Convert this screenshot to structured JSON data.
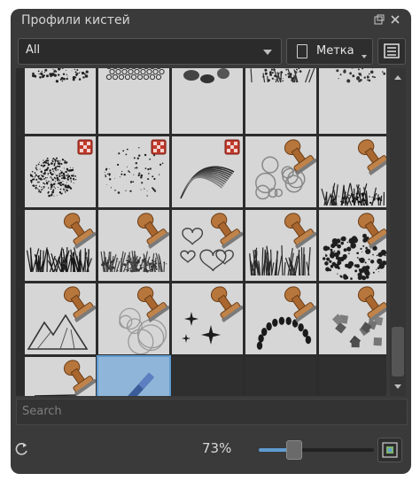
{
  "panel": {
    "title": "Профили кистей"
  },
  "filter": {
    "value": "All"
  },
  "tag_button": {
    "label": "Метка"
  },
  "search": {
    "placeholder": "Search"
  },
  "zoom": {
    "label": "73%",
    "level": 0.3
  },
  "brushes": [
    {
      "kind": "partial-dots"
    },
    {
      "kind": "partial-honeycomb"
    },
    {
      "kind": "partial-stones"
    },
    {
      "kind": "partial-splat"
    },
    {
      "kind": "partial-dots2"
    },
    {
      "kind": "spray",
      "badge": true
    },
    {
      "kind": "speckle",
      "badge": true
    },
    {
      "kind": "swirl",
      "badge": true
    },
    {
      "kind": "circles",
      "stamp": true
    },
    {
      "kind": "grass",
      "stamp": true
    },
    {
      "kind": "grass-dark",
      "stamp": true
    },
    {
      "kind": "grass-soft",
      "stamp": true
    },
    {
      "kind": "hearts",
      "stamp": true
    },
    {
      "kind": "tufts",
      "stamp": true
    },
    {
      "kind": "foliage",
      "stamp": true
    },
    {
      "kind": "mountains",
      "stamp": true
    },
    {
      "kind": "rings",
      "stamp": true
    },
    {
      "kind": "sparkles",
      "stamp": true
    },
    {
      "kind": "footprints",
      "stamp": true
    },
    {
      "kind": "puzzle",
      "stamp": true
    },
    {
      "kind": "strokes",
      "stamp": true
    },
    {
      "kind": "pen",
      "selected": true
    },
    {
      "kind": "empty"
    },
    {
      "kind": "empty"
    },
    {
      "kind": "empty"
    }
  ],
  "colors": {
    "accent": "#5f9bd1",
    "panel": "#3a3a3a",
    "badge": "#c0392b",
    "stamp": "#b07040"
  }
}
